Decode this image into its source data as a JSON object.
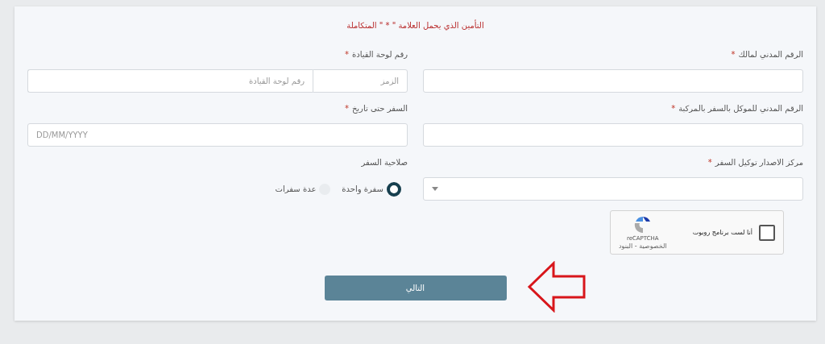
{
  "form": {
    "title": "التأمين الذي يحمل العلامة \" * \" المتكاملة",
    "fields": [
      {
        "kind": "text",
        "label": "الرقم المدني لمالك",
        "mark": "*"
      },
      {
        "kind": "plate",
        "label": "رقم لوحة القيادة",
        "mark": "*",
        "placeholders": [
          "الزمز",
          "رقم لوحة القيادة"
        ]
      },
      {
        "kind": "text",
        "label": "الرقم المدني للموكل بالسفر بالمركبة",
        "mark": "*"
      },
      {
        "kind": "text",
        "label": "السفر حتى تاريخ",
        "mark": "*",
        "placeholder": "DD/MM/YYYY"
      },
      {
        "kind": "select",
        "label": "مركز الاصدار توكيل السفر",
        "mark": "*"
      },
      {
        "kind": "radio",
        "label": "صلاحية السفر",
        "options": [
          {
            "label": "سفرة واحدة",
            "selected": true
          },
          {
            "label": "عدة سفرات",
            "selected": false
          }
        ]
      }
    ],
    "captcha": {
      "label": "أنا لست برنامج روبوت",
      "checked": false,
      "brand": "reCAPTCHA",
      "links": "الخصوصية - البنود"
    },
    "next_button": "التالي"
  }
}
